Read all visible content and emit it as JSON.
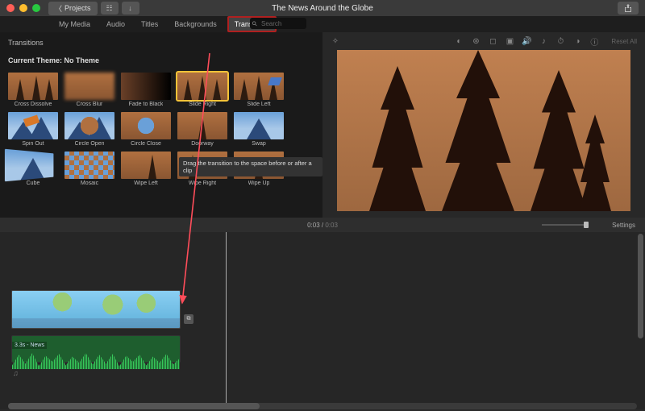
{
  "title": "The News Around the Globe",
  "back_button": "Projects",
  "tabs": {
    "my_media": "My Media",
    "audio": "Audio",
    "titles": "Titles",
    "backgrounds": "Backgrounds",
    "transitions": "Transitions"
  },
  "browser": {
    "section": "Transitions",
    "search_placeholder": "Search",
    "theme_label": "Current Theme:",
    "theme_value": "No Theme",
    "tooltip": "Drag the transition to the space before or after a clip",
    "items": [
      {
        "label": "Cross Dissolve"
      },
      {
        "label": "Cross Blur"
      },
      {
        "label": "Fade to Black"
      },
      {
        "label": "Slide Right"
      },
      {
        "label": "Slide Left"
      },
      {
        "label": "Spin Out"
      },
      {
        "label": "Circle Open"
      },
      {
        "label": "Circle Close"
      },
      {
        "label": "Doorway"
      },
      {
        "label": "Swap"
      },
      {
        "label": "Cube"
      },
      {
        "label": "Mosaic"
      },
      {
        "label": "Wipe Left"
      },
      {
        "label": "Wipe Right"
      },
      {
        "label": "Wipe Up"
      }
    ]
  },
  "viewer": {
    "reset": "Reset All"
  },
  "time": {
    "current": "0:03",
    "sep": " / ",
    "total": "0:03"
  },
  "settings_label": "Settings",
  "audio_clip_label": "3.3s - News"
}
